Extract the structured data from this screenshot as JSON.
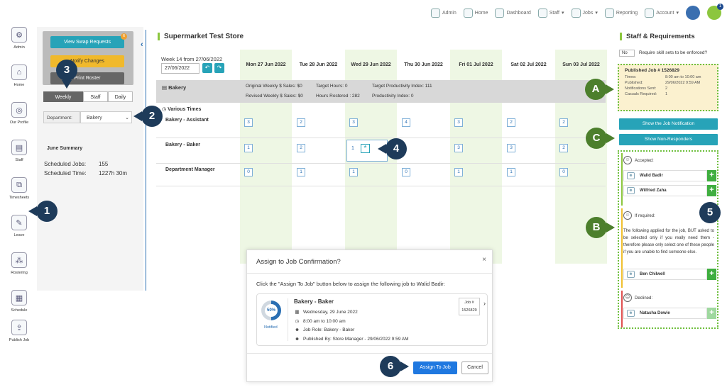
{
  "topnav": {
    "items": [
      {
        "label": "Admin",
        "icon": "admin-icon"
      },
      {
        "label": "Home",
        "icon": "home-icon"
      },
      {
        "label": "Dashboard",
        "icon": "dashboard-icon"
      },
      {
        "label": "Staff",
        "icon": "staff-icon"
      },
      {
        "label": "Jobs",
        "icon": "jobs-icon"
      },
      {
        "label": "Reporting",
        "icon": "reporting-icon"
      },
      {
        "label": "Account",
        "icon": "account-icon"
      }
    ],
    "notification_count": "1"
  },
  "iconbar": {
    "items": [
      {
        "label": "Admin"
      },
      {
        "label": "Home"
      },
      {
        "label": "Our Profile"
      },
      {
        "label": "Staff"
      },
      {
        "label": "Timesheets"
      },
      {
        "label": "Leave"
      },
      {
        "label": "Rostering"
      },
      {
        "label": "Schedule"
      },
      {
        "label": "Publish Job"
      }
    ]
  },
  "leftpanel": {
    "view_swap": "View Swap Requests",
    "swap_badge": "6",
    "notify": "Notify Changes",
    "roster": "Print Roster",
    "tabs": [
      "Weekly",
      "Staff",
      "Daily"
    ],
    "dept_label": "Department:",
    "dept_value": "Bakery",
    "summary_title": "June Summary",
    "jobs_label": "Scheduled Jobs:",
    "jobs_value": "155",
    "time_label": "Scheduled Time:",
    "time_value": "1227h 30m"
  },
  "main": {
    "store_title": "Supermarket Test Store",
    "week_label": "Week 14 from 27/06/2022",
    "week_input": "27/06/2022",
    "days": [
      "Mon 27 Jun 2022",
      "Tue 28 Jun 2022",
      "Wed 29 Jun 2022",
      "Thu 30 Jun 2022",
      "Fri 01 Jul 2022",
      "Sat 02 Jul 2022",
      "Sun 03 Jul 2022"
    ],
    "band": {
      "title": "Bakery",
      "orig_sales": "Original Weekly $ Sales: $0",
      "rev_sales": "Revised Weekly $ Sales: $0",
      "target_hours": "Target Hours: 0",
      "hours_rostered": "Hours Rostered : 282",
      "target_prod": "Target Productivity Index: 111",
      "prod": "Productivity Index: 0"
    },
    "various": "Various Times",
    "rows": [
      {
        "label": "Bakery - Assistant",
        "values": [
          "3",
          "2",
          "3",
          "4",
          "3",
          "2",
          "2"
        ]
      },
      {
        "label": "Bakery - Baker",
        "values": [
          "1",
          "2",
          "1",
          "",
          "3",
          "3",
          "2"
        ]
      },
      {
        "label": "Department Manager",
        "values": [
          "0",
          "1",
          "1",
          "0",
          "1",
          "1",
          "0"
        ]
      }
    ],
    "focus_star": "*"
  },
  "rightpanel": {
    "title": "Staff & Requirements",
    "toggle": "No",
    "toggle_label": "Require skill sets to be enforced?",
    "published_title": "Published Job # 1526829",
    "pub_rows": [
      {
        "k": "Times:",
        "v": "8:00 am to 10:00 am"
      },
      {
        "k": "Published:",
        "v": "29/06/2022 9:59 AM"
      },
      {
        "k": "Notifications Sent:",
        "v": "2"
      },
      {
        "k": "Casuals Required:",
        "v": "1"
      }
    ],
    "btn_show_notif": "Show the Job Notification",
    "btn_non_resp": "Show Non-Responders",
    "accepted": "Accepted:",
    "accepted_people": [
      "Walid Badir",
      "Wilfried Zaha"
    ],
    "if_required": "If required:",
    "if_required_text": "The following applied for the job, BUT asked to be selected only if you really need them - therefore please only select one of these people if you are unable to find someone else.",
    "if_required_people": [
      "Ben Chilwell"
    ],
    "declined": "Declined:",
    "declined_people": [
      "Natasha Dowie"
    ]
  },
  "modal": {
    "title": "Assign to Job Confirmation?",
    "close": "×",
    "message": "Click the \"Assign To Job\" button below to assign the following job to Walid Badir:",
    "gauge": "50%",
    "notified": "Notified",
    "job_title": "Bakery - Baker",
    "date": "Wednesday, 29 June 2022",
    "time": "8:00 am to 10:00 am",
    "role": "Job Role: Bakery - Baker",
    "published_by": "Published By: Store Manager - 29/06/2022 9:59 AM",
    "job_no_label": "Job #",
    "job_no": "1526829",
    "assign": "Assign To Job",
    "cancel": "Cancel"
  },
  "callouts": {
    "one": "1",
    "two": "2",
    "three": "3",
    "four": "4",
    "five": "5",
    "six": "6",
    "a": "A",
    "b": "B",
    "c": "C"
  },
  "colors": {
    "teal": "#27a3b8",
    "green_accent": "#8cc63e",
    "navy_callout": "#1e3b5a",
    "green_callout": "#4c7f2c",
    "assign_blue": "#1f78e0"
  }
}
